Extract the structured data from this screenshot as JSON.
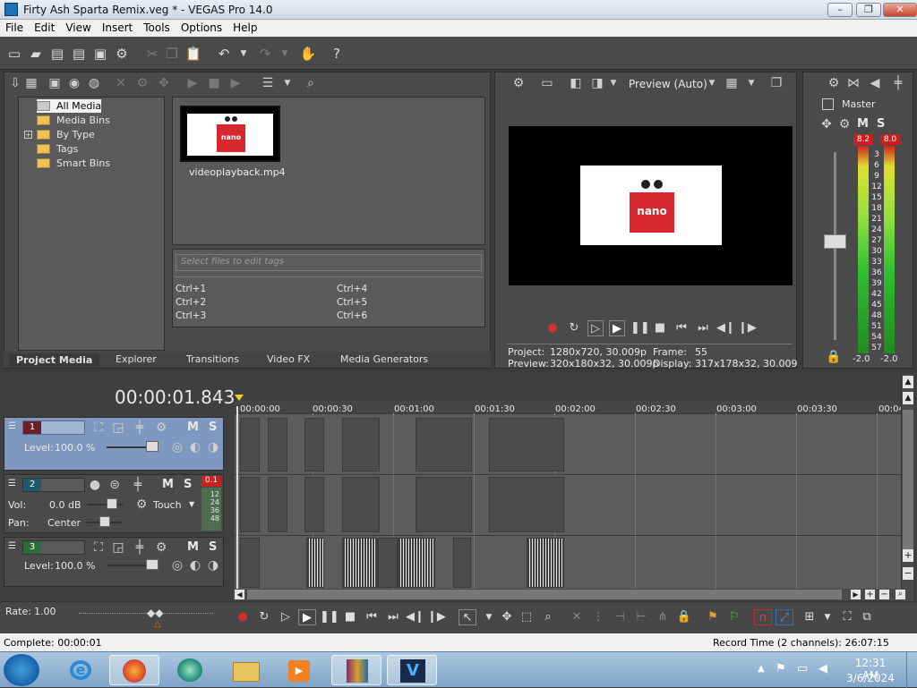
{
  "window": {
    "title": "Firty Ash Sparta Remix.veg * - VEGAS Pro 14.0"
  },
  "menu": [
    "File",
    "Edit",
    "View",
    "Insert",
    "Tools",
    "Options",
    "Help"
  ],
  "media_panel": {
    "tree": [
      "All Media",
      "Media Bins",
      "By Type",
      "Tags",
      "Smart Bins"
    ],
    "thumbnail": {
      "filename": "videoplayback.mp4",
      "logo_text": "nano"
    },
    "tag_placeholder": "Select files to edit tags",
    "shortcuts": [
      "Ctrl+1",
      "Ctrl+2",
      "Ctrl+3",
      "Ctrl+4",
      "Ctrl+5",
      "Ctrl+6"
    ],
    "tabs": [
      "Project Media",
      "Explorer",
      "Transitions",
      "Video FX",
      "Media Generators"
    ]
  },
  "preview": {
    "mode": "Preview (Auto)",
    "project_label": "Project:",
    "project_value": "1280x720, 30.009p",
    "preview_label": "Preview:",
    "preview_value": "320x180x32, 30.009p",
    "frame_label": "Frame:",
    "frame_value": "55",
    "display_label": "Display:",
    "display_value": "317x178x32, 30.009"
  },
  "master": {
    "label": "Master",
    "m": "M",
    "s": "S",
    "peak_left": "8.2",
    "peak_right": "8.0",
    "scale": [
      "3",
      "6",
      "9",
      "12",
      "15",
      "18",
      "21",
      "24",
      "27",
      "30",
      "33",
      "36",
      "39",
      "42",
      "45",
      "48",
      "51",
      "54",
      "57"
    ],
    "bottom_left": "-2.0",
    "bottom_right": "-2.0"
  },
  "timeline": {
    "timecode": "00:00:01.843",
    "ruler": [
      "00:00:00",
      "00:00:30",
      "00:01:00",
      "00:01:30",
      "00:02:00",
      "00:02:30",
      "00:03:00",
      "00:03:30",
      "00:04:"
    ],
    "tracks": [
      {
        "number": "1",
        "level_label": "Level:",
        "level_value": "100.0 %",
        "m": "M",
        "s": "S"
      },
      {
        "number": "2",
        "vol_label": "Vol:",
        "vol_value": "0.0 dB",
        "pan_label": "Pan:",
        "pan_value": "Center",
        "automation": "Touch",
        "peak": "0.1",
        "m": "M",
        "s": "S",
        "meter_scale": [
          "12",
          "24",
          "36",
          "48"
        ]
      },
      {
        "number": "3",
        "level_label": "Level:",
        "level_value": "100.0 %",
        "m": "M",
        "s": "S"
      }
    ]
  },
  "rate": {
    "label": "Rate:",
    "value": "1.00"
  },
  "status": {
    "left": "Complete: 00:00:01",
    "right": "Record Time (2 channels): 26:07:15"
  },
  "clock": {
    "time": "12:31 AM",
    "date": "3/6/2024"
  },
  "colors": {
    "accent_blue": "#1d6fb8",
    "track1_selected": "#6a8cbf",
    "record_red": "#c83232"
  }
}
